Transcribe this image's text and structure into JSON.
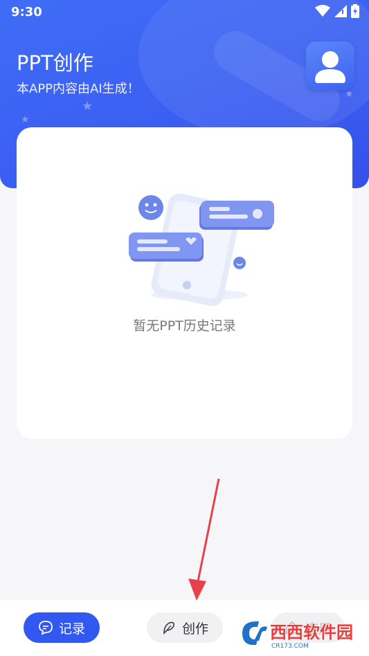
{
  "status_bar": {
    "time": "9:30"
  },
  "header": {
    "title": "PPT创作",
    "subtitle": "本APP内容由AI生成！"
  },
  "main": {
    "empty_message": "暂无PPT历史记录"
  },
  "bottom_nav": {
    "items": [
      {
        "label": "记录",
        "icon": "chat-bubble-icon",
        "active": true
      },
      {
        "label": "创作",
        "icon": "feather-icon",
        "active": false
      },
      {
        "label": "应用",
        "icon": "home-icon",
        "active": false
      }
    ]
  },
  "watermark": {
    "brand": "西西软件园",
    "site": "CR173.COM"
  },
  "colors": {
    "primary": "#3159f2",
    "header_gradient_start": "#3f6df7",
    "header_gradient_end": "#3451ea",
    "annotation_arrow": "#e8404a"
  }
}
